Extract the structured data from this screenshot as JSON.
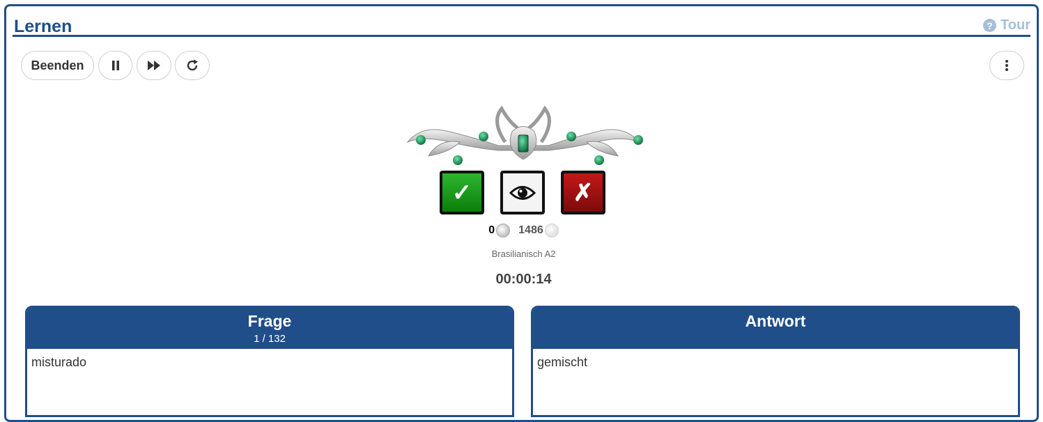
{
  "header": {
    "title": "Lernen",
    "tour_label": "Tour",
    "tour_icon": "question-circle-icon"
  },
  "toolbar": {
    "end_label": "Beenden",
    "pause_icon": "pause-icon",
    "skip_icon": "fast-forward-icon",
    "restart_icon": "refresh-icon",
    "menu_icon": "vertical-dots-icon"
  },
  "actions": {
    "correct_icon": "check-icon",
    "reveal_icon": "eye-icon",
    "wrong_icon": "cross-icon"
  },
  "scores": {
    "own": "0",
    "other": "1486"
  },
  "deck_name": "Brasilianisch A2",
  "timer": "00:00:14",
  "question": {
    "title": "Frage",
    "progress": "1 / 132",
    "text": "misturado"
  },
  "answer": {
    "title": "Antwort",
    "text": "gemischt"
  },
  "colors": {
    "primary": "#1f4e8a",
    "correct": "#1a9c1a",
    "wrong": "#a51212",
    "tour": "#a8bfd8"
  }
}
